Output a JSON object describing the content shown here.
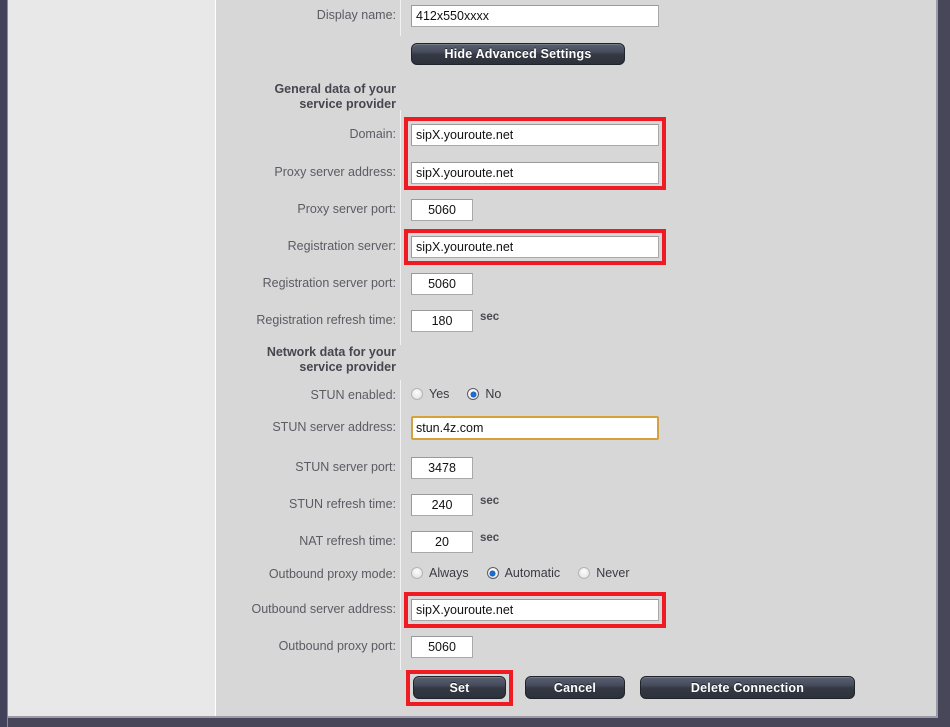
{
  "window": {
    "background_color": "#474759",
    "sidebar_color": "#e8e8e8",
    "content_color": "#d7d7d7",
    "annotation_color": "#ee1b22",
    "focus_border_color": "#d6a13c"
  },
  "form": {
    "display_name": {
      "label": "Display name:",
      "value": "412x550xxxx"
    },
    "advanced_toggle": {
      "label": "Hide Advanced Settings"
    },
    "sections": [
      {
        "id": "general",
        "heading": "General data of your\nservice provider",
        "fields": [
          {
            "id": "domain",
            "label": "Domain:",
            "value": "sipX.youroute.net",
            "type": "text",
            "highlighted": true
          },
          {
            "id": "proxy_address",
            "label": "Proxy server address:",
            "value": "sipX.youroute.net",
            "type": "text",
            "highlighted": true
          },
          {
            "id": "proxy_port",
            "label": "Proxy server port:",
            "value": "5060",
            "type": "number"
          },
          {
            "id": "reg_server",
            "label": "Registration server:",
            "value": "sipX.youroute.net",
            "type": "text",
            "highlighted": true
          },
          {
            "id": "reg_server_port",
            "label": "Registration server port:",
            "value": "5060",
            "type": "number"
          },
          {
            "id": "reg_refresh",
            "label": "Registration refresh time:",
            "value": "180",
            "type": "number",
            "unit": "sec"
          }
        ]
      },
      {
        "id": "network",
        "heading": "Network data for your\nservice provider",
        "fields": [
          {
            "id": "stun_enabled",
            "label": "STUN enabled:",
            "type": "radio",
            "options": [
              "Yes",
              "No"
            ],
            "selected": "No"
          },
          {
            "id": "stun_address",
            "label": "STUN server address:",
            "value": "stun.4z.com",
            "type": "text",
            "focused": true
          },
          {
            "id": "stun_port",
            "label": "STUN server port:",
            "value": "3478",
            "type": "number"
          },
          {
            "id": "stun_refresh",
            "label": "STUN refresh time:",
            "value": "240",
            "type": "number",
            "unit": "sec"
          },
          {
            "id": "nat_refresh",
            "label": "NAT refresh time:",
            "value": "20",
            "type": "number",
            "unit": "sec"
          },
          {
            "id": "outbound_mode",
            "label": "Outbound proxy mode:",
            "type": "radio",
            "options": [
              "Always",
              "Automatic",
              "Never"
            ],
            "selected": "Automatic"
          },
          {
            "id": "outbound_address",
            "label": "Outbound server address:",
            "value": "sipX.youroute.net",
            "type": "text",
            "highlighted": true
          },
          {
            "id": "outbound_port",
            "label": "Outbound proxy port:",
            "value": "5060",
            "type": "number"
          }
        ]
      }
    ],
    "actions": [
      {
        "id": "set",
        "label": "Set",
        "highlighted": true
      },
      {
        "id": "cancel",
        "label": "Cancel",
        "highlighted": false
      },
      {
        "id": "delete",
        "label": "Delete Connection",
        "highlighted": false
      }
    ]
  }
}
